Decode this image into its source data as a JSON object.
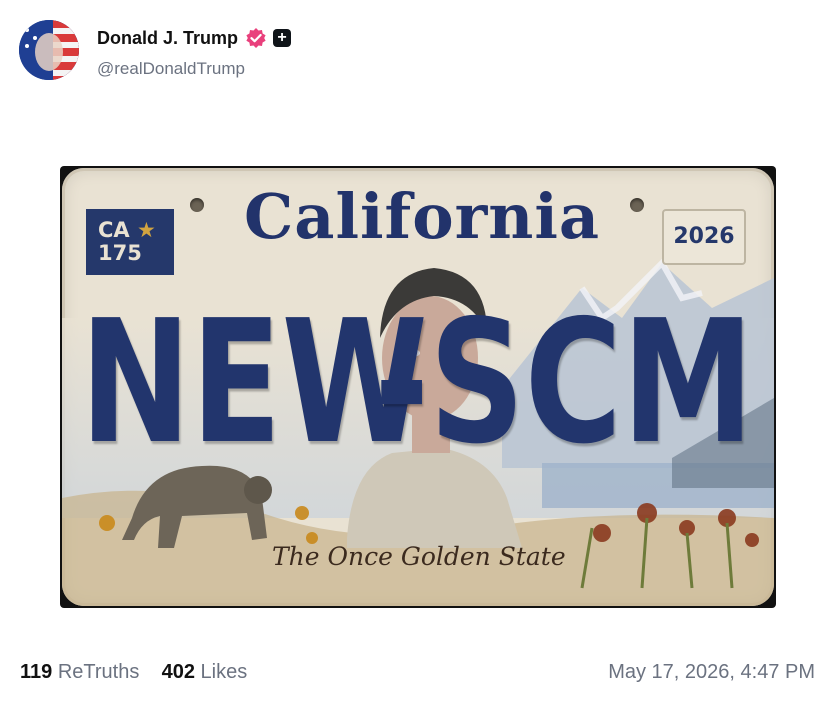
{
  "post": {
    "display_name": "Donald J. Trump",
    "handle": "@realDonaldTrump",
    "verified_icon": "verified-badge-icon",
    "badge_icon": "plus-square-icon"
  },
  "image": {
    "badge_line1": "CA",
    "badge_star": "★",
    "badge_line2": "175",
    "state": "California",
    "year": "2026",
    "plate_left": "NEW",
    "plate_right": "-SCM",
    "slogan": "The Once Golden State"
  },
  "stats": {
    "retruths_count": "119",
    "retruths_label": "ReTruths",
    "likes_count": "402",
    "likes_label": "Likes",
    "timestamp": "May 17, 2026, 4:47 PM"
  },
  "colors": {
    "plate_blue": "#22356d",
    "plate_bg": "#e9e2d3",
    "verified_pink": "#e91e63"
  }
}
